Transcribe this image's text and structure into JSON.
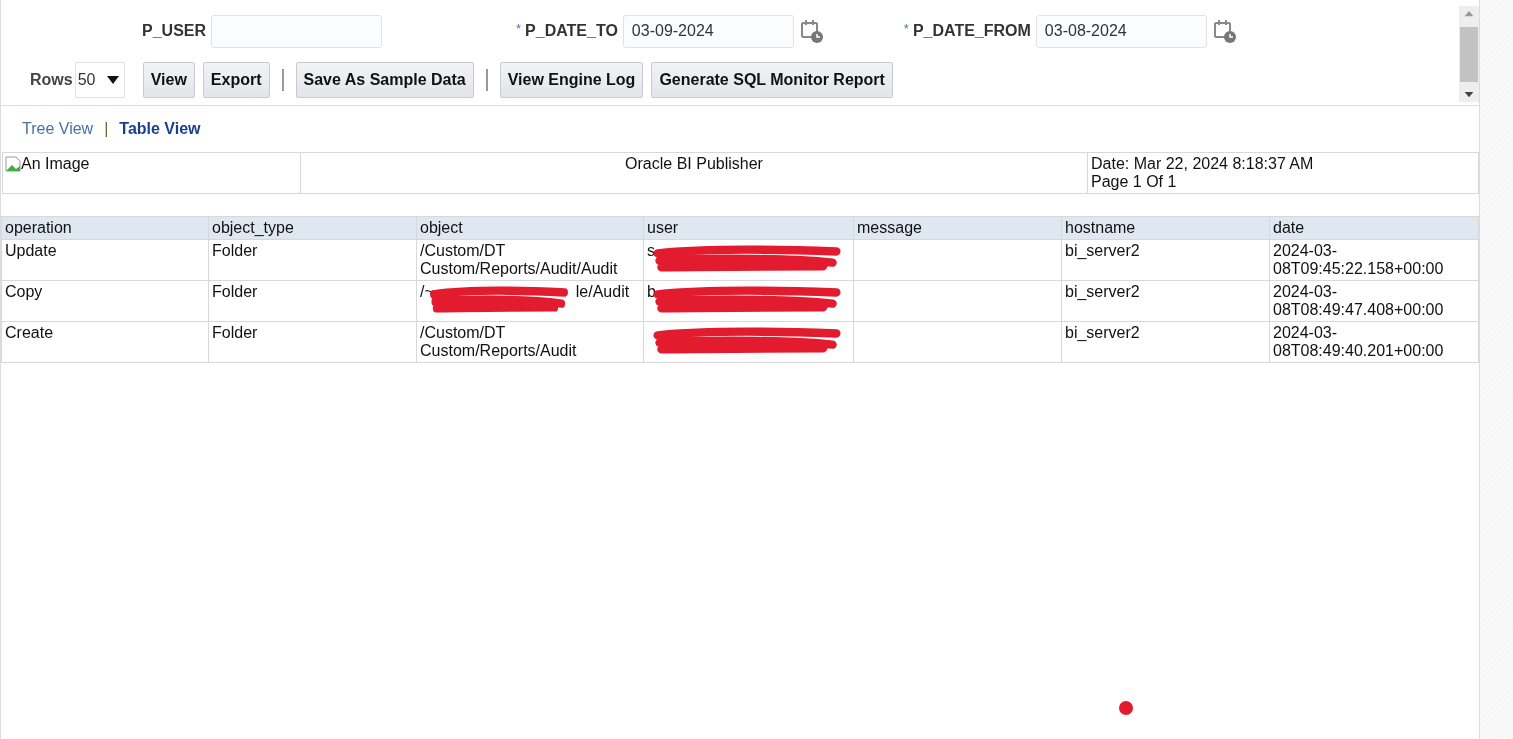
{
  "parameters": [
    {
      "label": "P_USER",
      "calendar": false
    },
    {
      "required_mark": "*",
      "label": "P_DATE_TO",
      "value": "03-09-2024",
      "calendar": true
    },
    {
      "required_mark": "*",
      "label": "P_DATE_FROM",
      "value": "03-08-2024",
      "calendar": true
    }
  ],
  "rows_label": "Rows",
  "rows_value": "50",
  "toolbar": [
    {
      "kind": "button",
      "label": "View"
    },
    {
      "kind": "button",
      "label": "Export"
    },
    {
      "kind": "separator"
    },
    {
      "kind": "button",
      "label": "Save As Sample Data"
    },
    {
      "kind": "separator"
    },
    {
      "kind": "button",
      "label": "View Engine Log"
    },
    {
      "kind": "button",
      "label": "Generate SQL Monitor Report"
    }
  ],
  "view_tab_separator": "|",
  "view_tabs": [
    {
      "label": "Tree View",
      "selected": false
    },
    {
      "label": "Table View",
      "selected": true
    }
  ],
  "report_header": {
    "image_alt": "An Image",
    "title": "Oracle BI Publisher",
    "date": "Date: Mar 22, 2024 8:18:37 AM",
    "page": "Page 1 Of 1"
  },
  "table": {
    "columns": [
      "operation",
      "object_type",
      "object",
      "user",
      "message",
      "hostname",
      "date"
    ],
    "rows": [
      [
        {
          "text": "Update"
        },
        {
          "text": "Folder"
        },
        {
          "text": "/Custom/DT Custom/Reports/Audit/Audit"
        },
        {
          "text": "s",
          "redacted": true
        },
        {},
        {
          "text": "bi_server2"
        },
        {
          "text": "2024-03-08T09:45:22.158+00:00"
        }
      ],
      [
        {
          "text": "Copy"
        },
        {
          "text": "Folder"
        },
        {
          "text": "/~",
          "after": "le/Audit",
          "redacted": true
        },
        {
          "text": "b",
          "redacted": true
        },
        {},
        {
          "text": "bi_server2"
        },
        {
          "text": "2024-03-08T08:49:47.408+00:00"
        }
      ],
      [
        {
          "text": "Create"
        },
        {
          "text": "Folder"
        },
        {
          "text": "/Custom/DT Custom/Reports/Audit"
        },
        {
          "redacted": true
        },
        {},
        {
          "text": "bi_server2"
        },
        {
          "text": "2024-03-08T08:49:40.201+00:00"
        }
      ]
    ]
  },
  "marker_dot": true
}
